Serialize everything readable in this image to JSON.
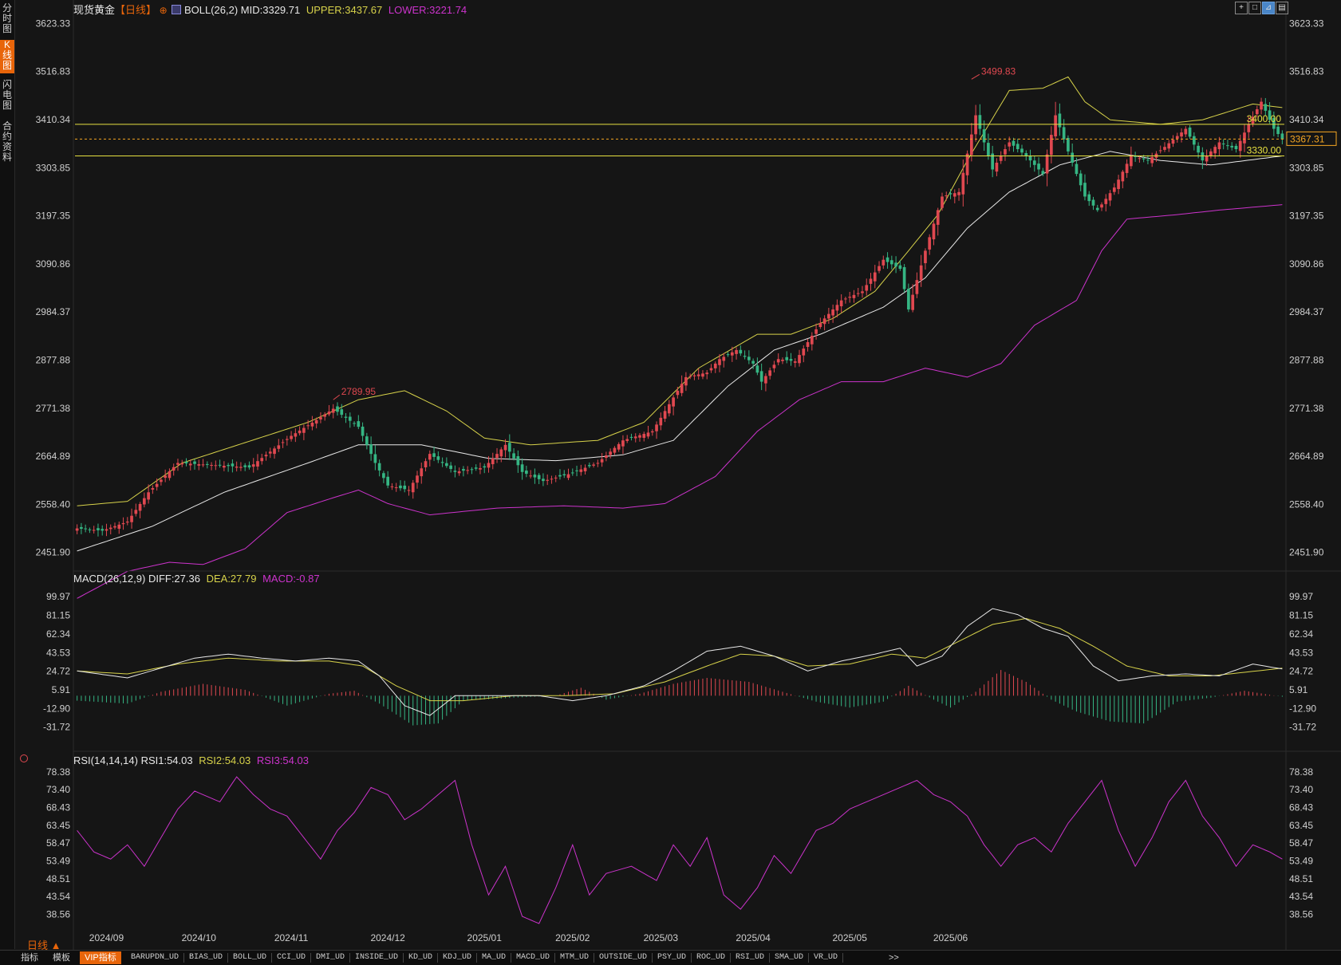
{
  "left_tabs": [
    {
      "label": "分\n时\n图",
      "active": false
    },
    {
      "label": "K\n线\n图",
      "active": true
    },
    {
      "label": "闪\n电\n图",
      "active": false
    },
    {
      "label": "合\n约\n资\n料",
      "active": false
    }
  ],
  "header": {
    "instrument": "现货黄金",
    "period": "【日线】",
    "boll_label": "BOLL(26,2)",
    "mid_text": "MID:3329.71",
    "upper_text": "UPPER:3437.67",
    "lower_text": "LOWER:3221.74"
  },
  "toolbar_icons": [
    "crosshair-icon",
    "zoom-fit-icon",
    "chart-mode-icon",
    "settings-icon"
  ],
  "price_levels": {
    "line_3400_label": "3400.00",
    "line_3330_label": "3330.00",
    "current_price_label": "3367.31",
    "high_marker": "3499.83",
    "low_marker": "2789.95"
  },
  "macd_header": {
    "label": "MACD(26,12,9)",
    "diff_text": "DIFF:27.36",
    "dea_text": "DEA:27.79",
    "macd_text": "MACD:-0.87"
  },
  "rsi_header": {
    "label": "RSI(14,14,14)",
    "rsi1_text": "RSI1:54.03",
    "rsi2_text": "RSI2:54.03",
    "rsi3_text": "RSI3:54.03"
  },
  "bottom_bar": {
    "period_button": "日线 ▲",
    "tabs": [
      "指标",
      "模板"
    ],
    "vip_tab": "VIP指标",
    "indicators": [
      "BARUPDN_UD",
      "BIAS_UD",
      "BOLL_UD",
      "CCI_UD",
      "DMI_UD",
      "INSIDE_UD",
      "KD_UD",
      "KDJ_UD",
      "MA_UD",
      "MACD_UD",
      "MTM_UD",
      "OUTSIDE_UD",
      "PSY_UD",
      "ROC_UD",
      "RSI_UD",
      "SMA_UD",
      "VR_UD"
    ],
    "more": ">>"
  },
  "colors": {
    "background": "#151515",
    "up": "#e04850",
    "down": "#35b583",
    "boll_mid": "#e8e8e8",
    "boll_upper": "#d7d24a",
    "boll_lower": "#cc33cc",
    "level_line": "#e6e040",
    "current_price": "#f5a623",
    "diff": "#e8e8e8",
    "dea": "#d7d24a",
    "rsi": "#cc33cc",
    "axis_text": "#cfcfcf"
  },
  "chart_data": [
    {
      "type": "candlestick",
      "title": "现货黄金 日线",
      "y_ticks": [
        "3623.33",
        "3516.83",
        "3410.34",
        "3303.85",
        "3197.35",
        "3090.86",
        "2984.37",
        "2877.88",
        "2771.38",
        "2664.89",
        "2558.40",
        "2451.90"
      ],
      "ylim": [
        2451.9,
        3623.33
      ],
      "x_ticks": [
        "2024/09",
        "2024/10",
        "2024/11",
        "2024/12",
        "2025/01",
        "2025/02",
        "2025/03",
        "2025/04",
        "2025/05",
        "2025/06"
      ],
      "close_anchors": [
        [
          0,
          2505
        ],
        [
          6,
          2500
        ],
        [
          12,
          2520
        ],
        [
          17,
          2585
        ],
        [
          24,
          2650
        ],
        [
          33,
          2645
        ],
        [
          41,
          2640
        ],
        [
          51,
          2710
        ],
        [
          57,
          2745
        ],
        [
          61,
          2770
        ],
        [
          67,
          2730
        ],
        [
          71,
          2650
        ],
        [
          74,
          2600
        ],
        [
          79,
          2590
        ],
        [
          84,
          2670
        ],
        [
          90,
          2630
        ],
        [
          97,
          2640
        ],
        [
          102,
          2690
        ],
        [
          106,
          2630
        ],
        [
          111,
          2610
        ],
        [
          117,
          2625
        ],
        [
          124,
          2650
        ],
        [
          130,
          2700
        ],
        [
          137,
          2720
        ],
        [
          145,
          2840
        ],
        [
          150,
          2850
        ],
        [
          153,
          2880
        ],
        [
          157,
          2900
        ],
        [
          161,
          2870
        ],
        [
          163,
          2830
        ],
        [
          167,
          2880
        ],
        [
          171,
          2875
        ],
        [
          177,
          2960
        ],
        [
          182,
          3010
        ],
        [
          187,
          3030
        ],
        [
          192,
          3100
        ],
        [
          196,
          3080
        ],
        [
          198,
          2990
        ],
        [
          202,
          3120
        ],
        [
          206,
          3240
        ],
        [
          210,
          3250
        ],
        [
          214,
          3420
        ],
        [
          218,
          3300
        ],
        [
          222,
          3360
        ],
        [
          226,
          3330
        ],
        [
          230,
          3290
        ],
        [
          233,
          3420
        ],
        [
          236,
          3340
        ],
        [
          240,
          3240
        ],
        [
          243,
          3210
        ],
        [
          247,
          3260
        ],
        [
          251,
          3330
        ],
        [
          255,
          3320
        ],
        [
          259,
          3350
        ],
        [
          264,
          3390
        ],
        [
          268,
          3320
        ],
        [
          272,
          3360
        ],
        [
          276,
          3345
        ],
        [
          279,
          3400
        ],
        [
          282,
          3450
        ],
        [
          285,
          3390
        ],
        [
          287,
          3367
        ]
      ],
      "boll_mid_anchors": [
        [
          0,
          2455
        ],
        [
          18,
          2510
        ],
        [
          35,
          2585
        ],
        [
          55,
          2650
        ],
        [
          67,
          2690
        ],
        [
          82,
          2690
        ],
        [
          98,
          2660
        ],
        [
          114,
          2655
        ],
        [
          130,
          2668
        ],
        [
          142,
          2700
        ],
        [
          155,
          2820
        ],
        [
          166,
          2900
        ],
        [
          177,
          2935
        ],
        [
          192,
          2995
        ],
        [
          202,
          3060
        ],
        [
          212,
          3170
        ],
        [
          222,
          3250
        ],
        [
          234,
          3310
        ],
        [
          246,
          3340
        ],
        [
          258,
          3320
        ],
        [
          270,
          3310
        ],
        [
          287,
          3330
        ]
      ],
      "boll_upper_anchors": [
        [
          0,
          2555
        ],
        [
          12,
          2565
        ],
        [
          25,
          2650
        ],
        [
          40,
          2695
        ],
        [
          55,
          2740
        ],
        [
          67,
          2790
        ],
        [
          78,
          2810
        ],
        [
          88,
          2765
        ],
        [
          97,
          2705
        ],
        [
          108,
          2690
        ],
        [
          124,
          2700
        ],
        [
          135,
          2740
        ],
        [
          148,
          2860
        ],
        [
          162,
          2935
        ],
        [
          170,
          2935
        ],
        [
          180,
          2970
        ],
        [
          190,
          3030
        ],
        [
          198,
          3120
        ],
        [
          205,
          3200
        ],
        [
          212,
          3320
        ],
        [
          222,
          3475
        ],
        [
          230,
          3480
        ],
        [
          236,
          3505
        ],
        [
          240,
          3450
        ],
        [
          246,
          3410
        ],
        [
          258,
          3400
        ],
        [
          268,
          3410
        ],
        [
          280,
          3445
        ],
        [
          287,
          3437
        ]
      ],
      "boll_lower_anchors": [
        [
          0,
          2350
        ],
        [
          12,
          2410
        ],
        [
          22,
          2430
        ],
        [
          30,
          2425
        ],
        [
          40,
          2460
        ],
        [
          50,
          2540
        ],
        [
          60,
          2570
        ],
        [
          67,
          2590
        ],
        [
          74,
          2560
        ],
        [
          84,
          2535
        ],
        [
          100,
          2550
        ],
        [
          116,
          2555
        ],
        [
          130,
          2550
        ],
        [
          140,
          2560
        ],
        [
          152,
          2620
        ],
        [
          162,
          2720
        ],
        [
          172,
          2790
        ],
        [
          182,
          2830
        ],
        [
          192,
          2830
        ],
        [
          202,
          2860
        ],
        [
          212,
          2840
        ],
        [
          220,
          2870
        ],
        [
          228,
          2955
        ],
        [
          238,
          3010
        ],
        [
          244,
          3120
        ],
        [
          250,
          3190
        ],
        [
          262,
          3200
        ],
        [
          272,
          3210
        ],
        [
          287,
          3222
        ]
      ]
    },
    {
      "type": "macd",
      "title": "MACD(26,12,9)",
      "y_ticks": [
        "99.97",
        "81.15",
        "62.34",
        "43.53",
        "24.72",
        "5.91",
        "-12.90",
        "-31.72"
      ],
      "ylim": [
        -31.72,
        99.97
      ],
      "diff_anchors": [
        [
          0,
          25
        ],
        [
          12,
          18
        ],
        [
          20,
          28
        ],
        [
          28,
          38
        ],
        [
          36,
          42
        ],
        [
          44,
          38
        ],
        [
          52,
          35
        ],
        [
          60,
          38
        ],
        [
          67,
          35
        ],
        [
          72,
          20
        ],
        [
          78,
          -10
        ],
        [
          84,
          -20
        ],
        [
          90,
          0
        ],
        [
          100,
          0
        ],
        [
          110,
          0
        ],
        [
          118,
          -5
        ],
        [
          126,
          0
        ],
        [
          135,
          10
        ],
        [
          142,
          25
        ],
        [
          150,
          45
        ],
        [
          158,
          50
        ],
        [
          166,
          40
        ],
        [
          174,
          25
        ],
        [
          182,
          35
        ],
        [
          190,
          42
        ],
        [
          196,
          48
        ],
        [
          200,
          30
        ],
        [
          206,
          40
        ],
        [
          212,
          70
        ],
        [
          218,
          88
        ],
        [
          224,
          82
        ],
        [
          230,
          68
        ],
        [
          236,
          60
        ],
        [
          242,
          30
        ],
        [
          248,
          15
        ],
        [
          256,
          20
        ],
        [
          264,
          22
        ],
        [
          272,
          20
        ],
        [
          280,
          32
        ],
        [
          287,
          27
        ]
      ],
      "dea_anchors": [
        [
          0,
          25
        ],
        [
          12,
          22
        ],
        [
          24,
          32
        ],
        [
          36,
          38
        ],
        [
          48,
          35
        ],
        [
          60,
          35
        ],
        [
          68,
          30
        ],
        [
          76,
          10
        ],
        [
          84,
          -5
        ],
        [
          92,
          -5
        ],
        [
          104,
          0
        ],
        [
          116,
          0
        ],
        [
          128,
          2
        ],
        [
          140,
          14
        ],
        [
          150,
          30
        ],
        [
          158,
          42
        ],
        [
          166,
          40
        ],
        [
          174,
          30
        ],
        [
          184,
          32
        ],
        [
          194,
          42
        ],
        [
          202,
          38
        ],
        [
          210,
          55
        ],
        [
          218,
          72
        ],
        [
          226,
          78
        ],
        [
          234,
          68
        ],
        [
          242,
          50
        ],
        [
          250,
          30
        ],
        [
          260,
          20
        ],
        [
          270,
          20
        ],
        [
          287,
          27.8
        ]
      ],
      "hist_anchors": [
        [
          0,
          -5
        ],
        [
          12,
          -8
        ],
        [
          20,
          4
        ],
        [
          30,
          12
        ],
        [
          40,
          6
        ],
        [
          50,
          -10
        ],
        [
          60,
          2
        ],
        [
          66,
          5
        ],
        [
          72,
          -8
        ],
        [
          80,
          -30
        ],
        [
          86,
          -28
        ],
        [
          92,
          -5
        ],
        [
          104,
          -2
        ],
        [
          114,
          0
        ],
        [
          120,
          8
        ],
        [
          126,
          -4
        ],
        [
          134,
          2
        ],
        [
          142,
          12
        ],
        [
          150,
          18
        ],
        [
          160,
          14
        ],
        [
          168,
          4
        ],
        [
          176,
          -6
        ],
        [
          184,
          -12
        ],
        [
          192,
          -6
        ],
        [
          198,
          10
        ],
        [
          204,
          -4
        ],
        [
          208,
          -12
        ],
        [
          214,
          4
        ],
        [
          220,
          26
        ],
        [
          226,
          14
        ],
        [
          232,
          -4
        ],
        [
          238,
          -16
        ],
        [
          246,
          -26
        ],
        [
          254,
          -28
        ],
        [
          262,
          -6
        ],
        [
          270,
          -2
        ],
        [
          278,
          5
        ],
        [
          287,
          -1
        ]
      ]
    },
    {
      "type": "line",
      "title": "RSI(14,14,14)",
      "y_ticks": [
        "78.38",
        "73.40",
        "68.43",
        "63.45",
        "58.47",
        "53.49",
        "48.51",
        "43.54",
        "38.56"
      ],
      "ylim": [
        36,
        79
      ],
      "rsi_anchors": [
        [
          0,
          62
        ],
        [
          4,
          56
        ],
        [
          8,
          54
        ],
        [
          12,
          58
        ],
        [
          16,
          52
        ],
        [
          20,
          60
        ],
        [
          24,
          68
        ],
        [
          28,
          73
        ],
        [
          34,
          70
        ],
        [
          38,
          77
        ],
        [
          42,
          72
        ],
        [
          46,
          68
        ],
        [
          50,
          66
        ],
        [
          54,
          60
        ],
        [
          58,
          54
        ],
        [
          62,
          62
        ],
        [
          66,
          67
        ],
        [
          70,
          74
        ],
        [
          74,
          72
        ],
        [
          78,
          65
        ],
        [
          82,
          68
        ],
        [
          86,
          72
        ],
        [
          90,
          76
        ],
        [
          94,
          58
        ],
        [
          98,
          44
        ],
        [
          102,
          52
        ],
        [
          106,
          38
        ],
        [
          110,
          36
        ],
        [
          114,
          46
        ],
        [
          118,
          58
        ],
        [
          122,
          44
        ],
        [
          126,
          50
        ],
        [
          132,
          52
        ],
        [
          138,
          48
        ],
        [
          142,
          58
        ],
        [
          146,
          52
        ],
        [
          150,
          60
        ],
        [
          154,
          44
        ],
        [
          158,
          40
        ],
        [
          162,
          46
        ],
        [
          166,
          55
        ],
        [
          170,
          50
        ],
        [
          176,
          62
        ],
        [
          180,
          64
        ],
        [
          184,
          68
        ],
        [
          188,
          70
        ],
        [
          192,
          72
        ],
        [
          196,
          74
        ],
        [
          200,
          76
        ],
        [
          204,
          72
        ],
        [
          208,
          70
        ],
        [
          212,
          66
        ],
        [
          216,
          58
        ],
        [
          220,
          52
        ],
        [
          224,
          58
        ],
        [
          228,
          60
        ],
        [
          232,
          56
        ],
        [
          236,
          64
        ],
        [
          240,
          70
        ],
        [
          244,
          76
        ],
        [
          248,
          62
        ],
        [
          252,
          52
        ],
        [
          256,
          60
        ],
        [
          260,
          70
        ],
        [
          264,
          76
        ],
        [
          268,
          66
        ],
        [
          272,
          60
        ],
        [
          276,
          52
        ],
        [
          280,
          58
        ],
        [
          284,
          56
        ],
        [
          287,
          54
        ]
      ]
    }
  ]
}
